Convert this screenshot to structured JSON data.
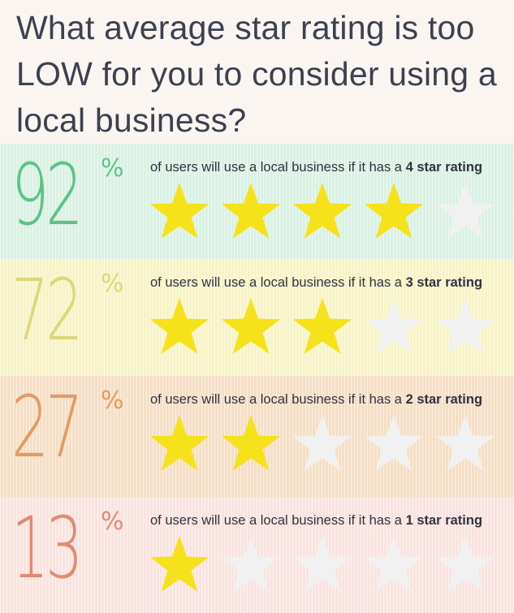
{
  "title": "What average star rating is too LOW for you to consider using a local business?",
  "chart_data": {
    "type": "table",
    "rows": [
      {
        "percent": "92",
        "percent_sign": "%",
        "caption_prefix": "of users will use a local business if it has a ",
        "caption_bold": "4 star rating",
        "stars_filled": 4,
        "stars_total": 5,
        "band_color": "#d9f1e3",
        "number_color": "#5ec287"
      },
      {
        "percent": "72",
        "percent_sign": "%",
        "caption_prefix": "of users will use a local business if it has a ",
        "caption_bold": "3 star rating",
        "stars_filled": 3,
        "stars_total": 5,
        "band_color": "#f7f3c5",
        "number_color": "#dcd77a"
      },
      {
        "percent": "27",
        "percent_sign": "%",
        "caption_prefix": "of users will use a local business if it has a ",
        "caption_bold": "2 star rating",
        "stars_filled": 2,
        "stars_total": 5,
        "band_color": "#f5dec5",
        "number_color": "#e29a63"
      },
      {
        "percent": "13",
        "percent_sign": "%",
        "caption_prefix": "of users will use a local business if it has a ",
        "caption_bold": "1 star rating",
        "stars_filled": 1,
        "stars_total": 5,
        "band_color": "#f9e3df",
        "number_color": "#df8a73"
      }
    ]
  },
  "colors": {
    "star_filled": "#f5e21b",
    "star_empty": "#f1f1f1",
    "title": "#3b4150",
    "caption": "#2f3340"
  }
}
